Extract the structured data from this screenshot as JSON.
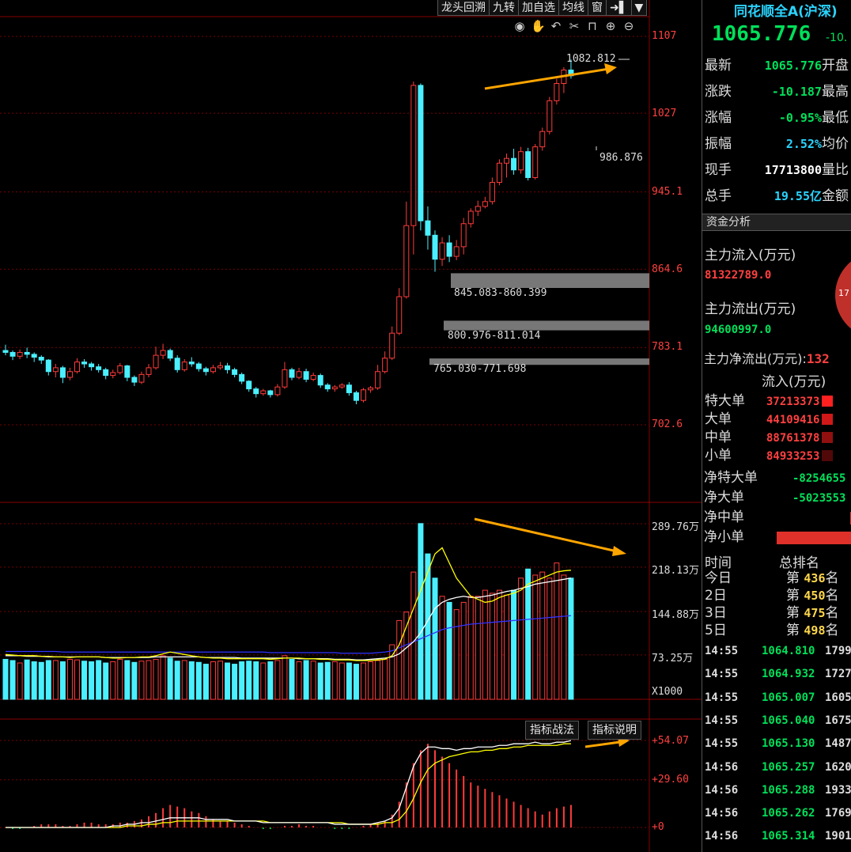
{
  "toolbar": [
    "龙头回溯",
    "九转",
    "加自选",
    "均线",
    "窗",
    "➜▌",
    "▼"
  ],
  "toolbar_icons": [
    "eye-icon",
    "hand-icon",
    "undo-icon",
    "scissors-icon",
    "lock-icon",
    "zoom-in-icon",
    "zoom-out-icon"
  ],
  "price_axis": [
    "1107",
    "1027",
    "945.1",
    "864.6",
    "783.1",
    "702.6"
  ],
  "price_high_note": "1082.812",
  "price_low_note": "986.876",
  "zones": [
    {
      "label": "845.083-860.399",
      "low": 845.083,
      "high": 860.399
    },
    {
      "label": "800.976-811.014",
      "low": 800.976,
      "high": 811.014
    },
    {
      "label": "765.030-771.698",
      "low": 765.03,
      "high": 771.698
    }
  ],
  "volume_axis": [
    "289.76万",
    "218.13万",
    "144.88万",
    "73.25万"
  ],
  "volume_unit": "X1000",
  "indicator_axis": [
    "+54.07",
    "+29.60",
    "+0"
  ],
  "indicator_buttons": {
    "tactics": "指标战法",
    "help": "指标说明"
  },
  "colors": {
    "up": "#ff3b3b",
    "down": "#4af0ff",
    "grid": "#7a0000",
    "arrow": "#ffa500",
    "ma5": "#ffff00",
    "ma10": "#ffffff",
    "ma20": "#3333ff"
  },
  "chart_data": {
    "type": "candlestick",
    "ylim": [
      660,
      1120
    ],
    "candles": [
      [
        780,
        778,
        786,
        775
      ],
      [
        778,
        774,
        780,
        770
      ],
      [
        774,
        778,
        781,
        771
      ],
      [
        778,
        776,
        783,
        772
      ],
      [
        776,
        773,
        778,
        768
      ],
      [
        773,
        770,
        775,
        766
      ],
      [
        770,
        758,
        771,
        754
      ],
      [
        758,
        762,
        766,
        752
      ],
      [
        762,
        752,
        764,
        746
      ],
      [
        752,
        758,
        762,
        749
      ],
      [
        758,
        768,
        772,
        756
      ],
      [
        768,
        766,
        771,
        762
      ],
      [
        766,
        763,
        768,
        759
      ],
      [
        763,
        760,
        766,
        757
      ],
      [
        760,
        754,
        762,
        750
      ],
      [
        754,
        757,
        760,
        751
      ],
      [
        757,
        764,
        767,
        755
      ],
      [
        764,
        752,
        765,
        748
      ],
      [
        752,
        747,
        754,
        743
      ],
      [
        747,
        755,
        758,
        745
      ],
      [
        755,
        762,
        766,
        752
      ],
      [
        762,
        775,
        784,
        760
      ],
      [
        775,
        780,
        787,
        771
      ],
      [
        780,
        772,
        782,
        769
      ],
      [
        772,
        760,
        775,
        757
      ],
      [
        760,
        768,
        771,
        758
      ],
      [
        768,
        766,
        773,
        763
      ],
      [
        766,
        761,
        768,
        758
      ],
      [
        761,
        758,
        763,
        754
      ],
      [
        758,
        762,
        765,
        756
      ],
      [
        762,
        764,
        768,
        760
      ],
      [
        764,
        760,
        767,
        756
      ],
      [
        760,
        755,
        762,
        752
      ],
      [
        755,
        748,
        757,
        745
      ],
      [
        748,
        740,
        749,
        737
      ],
      [
        740,
        735,
        742,
        731
      ],
      [
        735,
        738,
        740,
        733
      ],
      [
        738,
        734,
        739,
        731
      ],
      [
        734,
        742,
        745,
        732
      ],
      [
        742,
        760,
        768,
        740
      ],
      [
        760,
        752,
        762,
        749
      ],
      [
        752,
        758,
        762,
        750
      ],
      [
        758,
        750,
        761,
        747
      ],
      [
        750,
        754,
        757,
        748
      ],
      [
        754,
        744,
        756,
        741
      ],
      [
        744,
        740,
        746,
        737
      ],
      [
        740,
        742,
        744,
        737
      ],
      [
        742,
        744,
        746,
        740
      ],
      [
        744,
        736,
        747,
        733
      ],
      [
        736,
        728,
        738,
        724
      ],
      [
        728,
        739,
        741,
        726
      ],
      [
        739,
        741,
        743,
        736
      ],
      [
        741,
        758,
        765,
        739
      ],
      [
        758,
        772,
        779,
        756
      ],
      [
        772,
        798,
        805,
        770
      ],
      [
        798,
        836,
        845,
        796
      ],
      [
        836,
        910,
        935,
        834
      ],
      [
        910,
        1056,
        1060,
        880
      ],
      [
        1056,
        915,
        1058,
        905
      ],
      [
        915,
        900,
        930,
        885
      ],
      [
        900,
        875,
        905,
        862
      ],
      [
        875,
        892,
        898,
        868
      ],
      [
        892,
        878,
        900,
        872
      ],
      [
        878,
        888,
        895,
        874
      ],
      [
        888,
        912,
        918,
        880
      ],
      [
        912,
        925,
        928,
        908
      ],
      [
        925,
        930,
        936,
        920
      ],
      [
        930,
        935,
        940,
        928
      ],
      [
        935,
        955,
        960,
        932
      ],
      [
        955,
        975,
        979,
        952
      ],
      [
        975,
        980,
        985,
        960
      ],
      [
        980,
        968,
        990,
        963
      ],
      [
        968,
        987,
        992,
        964
      ],
      [
        987,
        960,
        991,
        957
      ],
      [
        960,
        992,
        995,
        958
      ],
      [
        992,
        1008,
        1012,
        988
      ],
      [
        1008,
        1040,
        1044,
        1005
      ],
      [
        1040,
        1058,
        1063,
        1036
      ],
      [
        1058,
        1072,
        1075,
        1048
      ],
      [
        1072,
        1066,
        1083,
        1063
      ]
    ],
    "volumes": [
      66,
      64,
      60,
      65,
      62,
      61,
      64,
      64,
      62,
      66,
      65,
      63,
      62,
      64,
      60,
      62,
      66,
      64,
      61,
      63,
      64,
      66,
      72,
      68,
      63,
      64,
      62,
      61,
      58,
      62,
      63,
      60,
      58,
      62,
      63,
      62,
      60,
      62,
      64,
      72,
      66,
      62,
      64,
      63,
      60,
      61,
      62,
      60,
      60,
      58,
      60,
      62,
      64,
      66,
      90,
      130,
      144,
      210,
      290,
      240,
      200,
      170,
      160,
      148,
      160,
      170,
      170,
      180,
      175,
      180,
      172,
      180,
      200,
      215,
      205,
      210,
      200,
      225,
      205,
      200
    ],
    "ma5": [
      74,
      73,
      72,
      72,
      72,
      71,
      71,
      70,
      70,
      69,
      70,
      70,
      70,
      70,
      69,
      68,
      68,
      69,
      69,
      70,
      70,
      72,
      75,
      78,
      76,
      74,
      72,
      70,
      69,
      68,
      68,
      67,
      67,
      67,
      67,
      67,
      67,
      66,
      67,
      68,
      68,
      68,
      67,
      67,
      66,
      66,
      65,
      65,
      65,
      64,
      64,
      64,
      65,
      66,
      72,
      90,
      120,
      150,
      180,
      210,
      240,
      250,
      225,
      200,
      185,
      170,
      165,
      160,
      162,
      168,
      172,
      175,
      180,
      190,
      195,
      200,
      205,
      210,
      212,
      213
    ],
    "ma10": [
      72,
      72,
      72,
      71,
      71,
      71,
      70,
      70,
      70,
      70,
      70,
      70,
      70,
      70,
      69,
      69,
      69,
      69,
      69,
      69,
      69,
      70,
      70,
      70,
      70,
      70,
      70,
      70,
      69,
      69,
      69,
      69,
      69,
      68,
      68,
      68,
      68,
      68,
      68,
      68,
      68,
      67,
      67,
      67,
      67,
      67,
      66,
      66,
      66,
      65,
      65,
      66,
      67,
      68,
      70,
      75,
      85,
      95,
      110,
      130,
      150,
      160,
      165,
      168,
      170,
      168,
      168,
      170,
      172,
      175,
      178,
      180,
      183,
      186,
      190,
      192,
      194,
      196,
      198,
      200
    ],
    "ma20": [
      79,
      79,
      79,
      79,
      79,
      79,
      79,
      79,
      78,
      78,
      78,
      78,
      78,
      78,
      78,
      78,
      78,
      78,
      78,
      78,
      78,
      78,
      78,
      78,
      78,
      78,
      78,
      78,
      78,
      78,
      78,
      78,
      78,
      78,
      78,
      78,
      78,
      77,
      77,
      77,
      77,
      77,
      77,
      77,
      77,
      77,
      77,
      76,
      76,
      76,
      76,
      76,
      77,
      78,
      80,
      85,
      90,
      95,
      100,
      105,
      110,
      115,
      118,
      120,
      122,
      124,
      125,
      126,
      127,
      128,
      129,
      130,
      131,
      132,
      133,
      134,
      135,
      136,
      137,
      138
    ],
    "macd_dif": [
      0,
      0,
      0,
      0,
      0,
      0,
      0,
      0,
      0,
      0,
      0,
      0,
      0,
      0,
      0,
      1,
      1,
      2,
      2,
      3,
      3,
      4,
      5,
      6,
      6,
      6,
      6,
      6,
      5,
      5,
      5,
      5,
      4,
      4,
      4,
      4,
      3,
      3,
      3,
      3,
      3,
      3,
      3,
      3,
      3,
      3,
      2,
      2,
      2,
      2,
      2,
      2,
      3,
      4,
      6,
      12,
      25,
      38,
      46,
      50,
      50,
      49,
      49,
      48,
      49,
      49,
      50,
      50,
      50,
      51,
      51,
      52,
      52,
      52,
      53,
      52,
      52,
      53,
      53,
      54
    ],
    "macd_dea": [
      0,
      0,
      0,
      0,
      0,
      0,
      0,
      0,
      0,
      0,
      0,
      0,
      0,
      0,
      0,
      0,
      0,
      1,
      1,
      1,
      2,
      2,
      3,
      3,
      4,
      4,
      4,
      4,
      4,
      4,
      4,
      4,
      4,
      4,
      4,
      4,
      4,
      3,
      3,
      3,
      3,
      3,
      3,
      3,
      3,
      3,
      3,
      3,
      2,
      2,
      2,
      2,
      2,
      3,
      3,
      5,
      10,
      18,
      28,
      36,
      40,
      42,
      44,
      45,
      46,
      47,
      47,
      48,
      48,
      49,
      49,
      50,
      50,
      51,
      51,
      51,
      51,
      51,
      52,
      52
    ],
    "macd_hist": [
      0,
      -1,
      -1,
      0,
      1,
      2,
      2,
      2,
      1,
      1,
      2,
      3,
      3,
      2,
      2,
      2,
      3,
      3,
      4,
      5,
      7,
      9,
      12,
      14,
      13,
      12,
      10,
      9,
      7,
      5,
      4,
      4,
      3,
      2,
      1,
      0,
      -1,
      -1,
      0,
      1,
      1,
      2,
      1,
      1,
      0,
      0,
      -1,
      -1,
      -1,
      0,
      1,
      2,
      3,
      4,
      8,
      16,
      28,
      40,
      48,
      52,
      48,
      44,
      40,
      36,
      32,
      28,
      26,
      24,
      22,
      20,
      18,
      16,
      14,
      12,
      10,
      8,
      10,
      12,
      13,
      14
    ]
  },
  "panel": {
    "title": "同花顺全A(沪深)",
    "price": "1065.776",
    "change_short": "-10.",
    "quote": [
      {
        "k": "最新",
        "v": "1065.776",
        "c": "#00e05a",
        "k2": "开盘"
      },
      {
        "k": "涨跌",
        "v": "-10.187",
        "c": "#00e05a",
        "k2": "最高"
      },
      {
        "k": "涨幅",
        "v": "-0.95%",
        "c": "#00e05a",
        "k2": "最低"
      },
      {
        "k": "振幅",
        "v": "2.52%",
        "c": "#2ad4ff",
        "k2": "均价"
      },
      {
        "k": "现手",
        "v": "17713800",
        "c": "#ffffff",
        "k2": "量比"
      },
      {
        "k": "总手",
        "v": "19.55亿",
        "c": "#2ad4ff",
        "k2": "金额"
      }
    ],
    "fund_section": "资金分析",
    "main_in_label": "主力流入(万元)",
    "main_in_value": "81322789.0",
    "main_out_label": "主力流出(万元)",
    "main_out_value": "94600997.0",
    "pie_text": "17",
    "net_label": "主力净流出(万元):",
    "net_value": "132",
    "inflow_head": "流入(万元)",
    "inflow": [
      {
        "k": "特大单",
        "v": "37213373",
        "c": "#ff2020"
      },
      {
        "k": "大单",
        "v": "44109416",
        "c": "#d01818"
      },
      {
        "k": "中单",
        "v": "88761378",
        "c": "#901010"
      },
      {
        "k": "小单",
        "v": "84933253",
        "c": "#500808"
      }
    ],
    "net": [
      {
        "k": "净特大单",
        "v": "-8254655"
      },
      {
        "k": "净大单",
        "v": "-5023553"
      },
      {
        "k": "净中单",
        "v": ""
      },
      {
        "k": "净小单",
        "v": ""
      }
    ],
    "rank_time": "时间",
    "rank_title": "总排名",
    "ranks": [
      {
        "k": "今日",
        "n": "436"
      },
      {
        "k": "2日",
        "n": "450"
      },
      {
        "k": "3日",
        "n": "475"
      },
      {
        "k": "5日",
        "n": "498"
      }
    ],
    "rank_prefix": "第",
    "rank_suffix": "名",
    "ticks": [
      {
        "t": "14:55",
        "p": "1064.810",
        "v": "1799"
      },
      {
        "t": "14:55",
        "p": "1064.932",
        "v": "1727"
      },
      {
        "t": "14:55",
        "p": "1065.007",
        "v": "1605"
      },
      {
        "t": "14:55",
        "p": "1065.040",
        "v": "1675"
      },
      {
        "t": "14:55",
        "p": "1065.130",
        "v": "1487"
      },
      {
        "t": "14:56",
        "p": "1065.257",
        "v": "1620"
      },
      {
        "t": "14:56",
        "p": "1065.288",
        "v": "1933"
      },
      {
        "t": "14:56",
        "p": "1065.262",
        "v": "1769"
      },
      {
        "t": "14:56",
        "p": "1065.314",
        "v": "1901"
      }
    ]
  }
}
